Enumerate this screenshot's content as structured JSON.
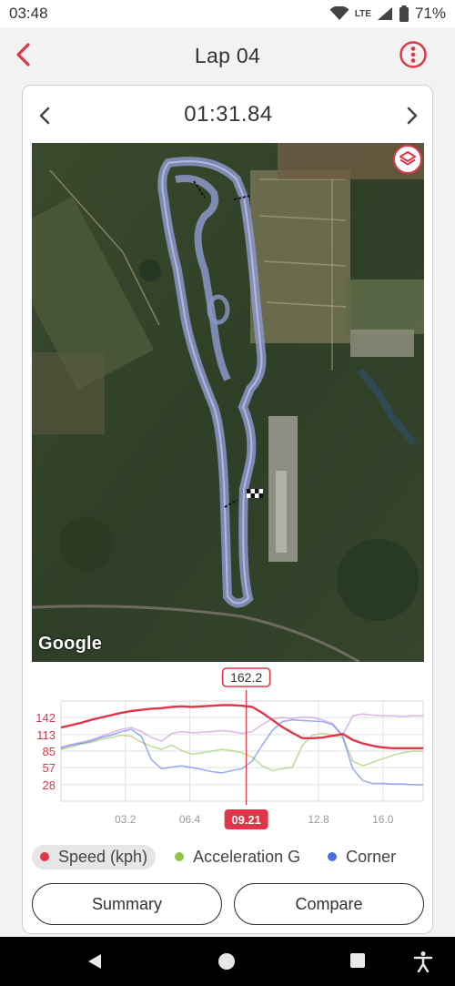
{
  "status_bar": {
    "time": "03:48",
    "network_label": "LTE",
    "battery": "71%"
  },
  "app_bar": {
    "title": "Lap 04"
  },
  "lap": {
    "time": "01:31.84"
  },
  "map": {
    "attribution": "Google"
  },
  "colors": {
    "accent": "#e0364a",
    "speed": "#e0364a",
    "acceleration": "#8fc34a",
    "corner": "#4a6ee0",
    "extra": "#c57fd6"
  },
  "chart_data": {
    "type": "line",
    "x": [
      0,
      0.5,
      1,
      1.5,
      2,
      2.5,
      3,
      3.5,
      4,
      4.5,
      5,
      5.5,
      6,
      6.5,
      7,
      7.5,
      8,
      8.5,
      9,
      9.5,
      10,
      10.5,
      11,
      11.5,
      12,
      12.5,
      13,
      13.5,
      14,
      14.5,
      15,
      15.5,
      16,
      16.5,
      17,
      17.5,
      18
    ],
    "x_ticks": [
      "03.2",
      "06.4",
      "12.8",
      "16.0"
    ],
    "x_tick_values": [
      3.2,
      6.4,
      12.8,
      16.0
    ],
    "y_ticks": [
      "142",
      "113",
      "85",
      "57",
      "28"
    ],
    "y_tick_values": [
      142,
      113,
      85,
      57,
      28
    ],
    "ylim": [
      0,
      170
    ],
    "cursor": {
      "x": 9.21,
      "x_label": "09.21",
      "value_label": "162.2"
    },
    "grid": true,
    "series": [
      {
        "name": "Speed (kph)",
        "color": "#e0364a",
        "values": [
          125,
          129,
          133,
          138,
          142,
          146,
          150,
          153,
          155,
          157,
          158,
          160,
          161,
          160,
          161,
          162,
          163,
          163,
          162,
          160,
          150,
          138,
          126,
          116,
          107,
          107,
          108,
          111,
          114,
          104,
          98,
          94,
          91,
          90,
          90,
          90,
          90
        ]
      },
      {
        "name": "Acceleration G",
        "color": "#8fc34a",
        "values": [
          88,
          92,
          97,
          100,
          105,
          108,
          112,
          110,
          100,
          93,
          88,
          95,
          86,
          80,
          82,
          85,
          88,
          86,
          82,
          75,
          60,
          52,
          55,
          58,
          95,
          112,
          115,
          112,
          108,
          68,
          60,
          66,
          72,
          78,
          82,
          85,
          85
        ]
      },
      {
        "name": "Corner",
        "color": "#4a6ee0",
        "values": [
          90,
          95,
          98,
          102,
          108,
          112,
          118,
          122,
          110,
          70,
          55,
          58,
          60,
          57,
          54,
          50,
          48,
          52,
          55,
          68,
          95,
          120,
          135,
          138,
          137,
          136,
          135,
          130,
          110,
          55,
          35,
          30,
          30,
          29,
          29,
          28,
          28
        ]
      },
      {
        "color": "#c57fd6",
        "values": [
          92,
          96,
          100,
          104,
          110,
          116,
          122,
          125,
          118,
          108,
          102,
          115,
          118,
          116,
          117,
          118,
          120,
          118,
          115,
          118,
          130,
          140,
          142,
          140,
          143,
          142,
          138,
          132,
          112,
          145,
          148,
          146,
          145,
          145,
          144,
          145,
          145
        ]
      }
    ]
  },
  "legend": {
    "items": [
      {
        "label": "Speed (kph)"
      },
      {
        "label": "Acceleration G"
      },
      {
        "label": "Corner"
      }
    ]
  },
  "buttons": {
    "summary": "Summary",
    "compare": "Compare"
  },
  "icons": {
    "back": "chevron-left-icon",
    "more": "more-vert-icon",
    "prev": "chevron-left-icon",
    "next": "chevron-right-icon",
    "layers": "layers-icon",
    "nav_back": "triangle-back-icon",
    "nav_home": "circle-home-icon",
    "nav_recents": "square-recents-icon",
    "accessibility": "accessibility-icon"
  }
}
